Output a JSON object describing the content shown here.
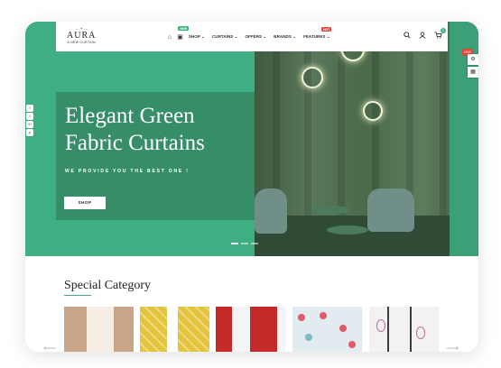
{
  "header": {
    "logo_title": "AURA",
    "logo_subtitle": "A NEW CURTAIN",
    "nav": [
      {
        "label": "SHOP",
        "chevron": "⌄"
      },
      {
        "label": "CURTAINS",
        "chevron": "⌄"
      },
      {
        "label": "OFFERS",
        "chevron": "⌄"
      },
      {
        "label": "BRANDS",
        "chevron": "⌄"
      },
      {
        "label": "FEATURES",
        "chevron": "⌄"
      }
    ],
    "badges": {
      "new": "NEW",
      "hot": "HOT"
    },
    "cart_count": "0",
    "icons": [
      "home-icon",
      "catalog-icon",
      "search-icon",
      "user-icon",
      "cart-icon"
    ]
  },
  "hero": {
    "title": "Elegant Green Fabric Curtains",
    "tagline": "WE PROVIDE YOU THE BEST ONE !",
    "cta": "SHOP"
  },
  "social": [
    "f",
    "t",
    "in",
    "p"
  ],
  "side_widget": {
    "badge": "NEW"
  },
  "category": {
    "heading": "Special Category",
    "items": [
      {
        "name": "beige-sheer-curtain",
        "colors": [
          "#c9a58a",
          "#e6d2bf",
          "#f6ede4"
        ]
      },
      {
        "name": "yellow-pattern-curtain",
        "colors": [
          "#e5c43d",
          "#f1db6b",
          "#ffffff"
        ]
      },
      {
        "name": "red-drape-curtain",
        "colors": [
          "#c42a2a",
          "#e5e5e5",
          "#f4f4f4"
        ]
      },
      {
        "name": "floral-curtain",
        "colors": [
          "#e2ecf0",
          "#e05b6a",
          "#7fb9c3"
        ]
      },
      {
        "name": "leaf-print-curtain",
        "colors": [
          "#f4f1f3",
          "#b86f99",
          "#3d3d3d"
        ]
      }
    ]
  },
  "colors": {
    "brand": "#3fae83",
    "hero_overlay": "#348864",
    "accent_red": "#e8453c"
  }
}
